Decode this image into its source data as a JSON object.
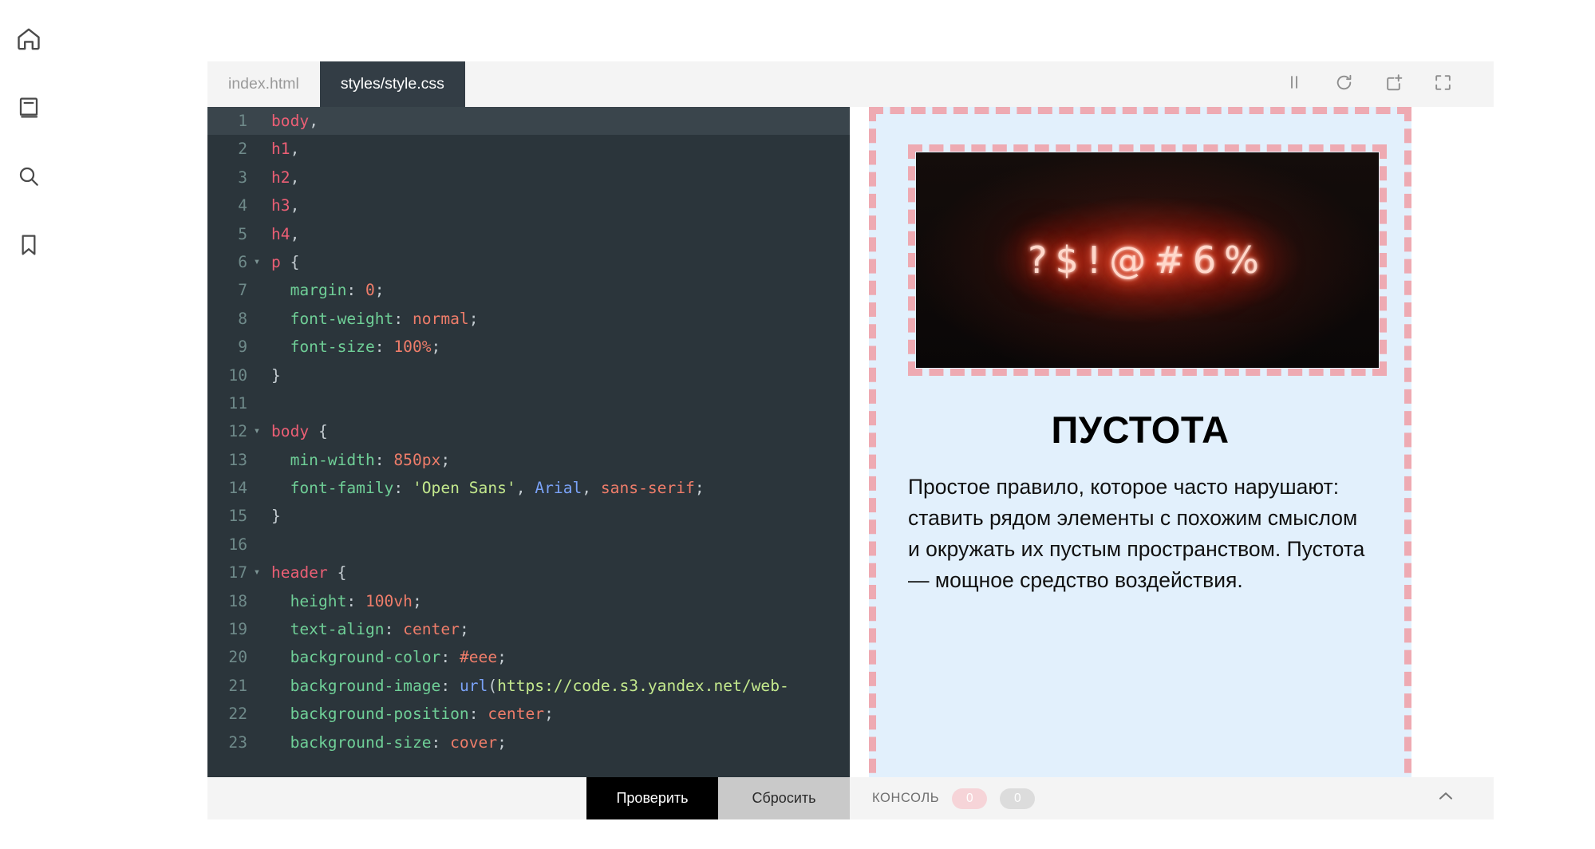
{
  "rail": {
    "items": [
      {
        "name": "home-icon",
        "label": "Home"
      },
      {
        "name": "book-icon",
        "label": "Textbook"
      },
      {
        "name": "search-icon",
        "label": "Search"
      },
      {
        "name": "bookmark-icon",
        "label": "Bookmarks"
      }
    ]
  },
  "editor": {
    "tabs": [
      {
        "label": "index.html",
        "active": false
      },
      {
        "label": "styles/style.css",
        "active": true
      }
    ],
    "active_line": 1,
    "lines": [
      {
        "n": "1",
        "fold": "",
        "cur": true,
        "tokens": [
          {
            "t": "sel",
            "s": "body"
          },
          {
            "t": "pun",
            "s": ","
          }
        ]
      },
      {
        "n": "2",
        "fold": "",
        "cur": false,
        "tokens": [
          {
            "t": "sel",
            "s": "h1"
          },
          {
            "t": "pun",
            "s": ","
          }
        ]
      },
      {
        "n": "3",
        "fold": "",
        "cur": false,
        "tokens": [
          {
            "t": "sel",
            "s": "h2"
          },
          {
            "t": "pun",
            "s": ","
          }
        ]
      },
      {
        "n": "4",
        "fold": "",
        "cur": false,
        "tokens": [
          {
            "t": "sel",
            "s": "h3"
          },
          {
            "t": "pun",
            "s": ","
          }
        ]
      },
      {
        "n": "5",
        "fold": "",
        "cur": false,
        "tokens": [
          {
            "t": "sel",
            "s": "h4"
          },
          {
            "t": "pun",
            "s": ","
          }
        ]
      },
      {
        "n": "6",
        "fold": "▾",
        "cur": false,
        "tokens": [
          {
            "t": "sel",
            "s": "p"
          },
          {
            "t": "pun",
            "s": " {"
          }
        ]
      },
      {
        "n": "7",
        "fold": "",
        "cur": false,
        "tokens": [
          {
            "t": "prop",
            "s": "  margin"
          },
          {
            "t": "pun",
            "s": ": "
          },
          {
            "t": "num",
            "s": "0"
          },
          {
            "t": "pun",
            "s": ";"
          }
        ]
      },
      {
        "n": "8",
        "fold": "",
        "cur": false,
        "tokens": [
          {
            "t": "prop",
            "s": "  font-weight"
          },
          {
            "t": "pun",
            "s": ": "
          },
          {
            "t": "val",
            "s": "normal"
          },
          {
            "t": "pun",
            "s": ";"
          }
        ]
      },
      {
        "n": "9",
        "fold": "",
        "cur": false,
        "tokens": [
          {
            "t": "prop",
            "s": "  font-size"
          },
          {
            "t": "pun",
            "s": ": "
          },
          {
            "t": "num",
            "s": "100%"
          },
          {
            "t": "pun",
            "s": ";"
          }
        ]
      },
      {
        "n": "10",
        "fold": "",
        "cur": false,
        "tokens": [
          {
            "t": "pun",
            "s": "}"
          }
        ]
      },
      {
        "n": "11",
        "fold": "",
        "cur": false,
        "tokens": []
      },
      {
        "n": "12",
        "fold": "▾",
        "cur": false,
        "tokens": [
          {
            "t": "sel",
            "s": "body"
          },
          {
            "t": "pun",
            "s": " {"
          }
        ]
      },
      {
        "n": "13",
        "fold": "",
        "cur": false,
        "tokens": [
          {
            "t": "prop",
            "s": "  min-width"
          },
          {
            "t": "pun",
            "s": ": "
          },
          {
            "t": "num",
            "s": "850px"
          },
          {
            "t": "pun",
            "s": ";"
          }
        ]
      },
      {
        "n": "14",
        "fold": "",
        "cur": false,
        "tokens": [
          {
            "t": "prop",
            "s": "  font-family"
          },
          {
            "t": "pun",
            "s": ": "
          },
          {
            "t": "str",
            "s": "'Open Sans'"
          },
          {
            "t": "pun",
            "s": ", "
          },
          {
            "t": "fn",
            "s": "Arial"
          },
          {
            "t": "pun",
            "s": ", "
          },
          {
            "t": "val",
            "s": "sans-serif"
          },
          {
            "t": "pun",
            "s": ";"
          }
        ]
      },
      {
        "n": "15",
        "fold": "",
        "cur": false,
        "tokens": [
          {
            "t": "pun",
            "s": "}"
          }
        ]
      },
      {
        "n": "16",
        "fold": "",
        "cur": false,
        "tokens": []
      },
      {
        "n": "17",
        "fold": "▾",
        "cur": false,
        "tokens": [
          {
            "t": "sel",
            "s": "header"
          },
          {
            "t": "pun",
            "s": " {"
          }
        ]
      },
      {
        "n": "18",
        "fold": "",
        "cur": false,
        "tokens": [
          {
            "t": "prop",
            "s": "  height"
          },
          {
            "t": "pun",
            "s": ": "
          },
          {
            "t": "num",
            "s": "100vh"
          },
          {
            "t": "pun",
            "s": ";"
          }
        ]
      },
      {
        "n": "19",
        "fold": "",
        "cur": false,
        "tokens": [
          {
            "t": "prop",
            "s": "  text-align"
          },
          {
            "t": "pun",
            "s": ": "
          },
          {
            "t": "val",
            "s": "center"
          },
          {
            "t": "pun",
            "s": ";"
          }
        ]
      },
      {
        "n": "20",
        "fold": "",
        "cur": false,
        "tokens": [
          {
            "t": "prop",
            "s": "  background-color"
          },
          {
            "t": "pun",
            "s": ": "
          },
          {
            "t": "val",
            "s": "#eee"
          },
          {
            "t": "pun",
            "s": ";"
          }
        ]
      },
      {
        "n": "21",
        "fold": "",
        "cur": false,
        "tokens": [
          {
            "t": "prop",
            "s": "  background-image"
          },
          {
            "t": "pun",
            "s": ": "
          },
          {
            "t": "fn",
            "s": "url"
          },
          {
            "t": "pun",
            "s": "("
          },
          {
            "t": "str",
            "s": "https://code.s3.yandex.net/web-"
          }
        ]
      },
      {
        "n": "22",
        "fold": "",
        "cur": false,
        "tokens": [
          {
            "t": "prop",
            "s": "  background-position"
          },
          {
            "t": "pun",
            "s": ": "
          },
          {
            "t": "val",
            "s": "center"
          },
          {
            "t": "pun",
            "s": ";"
          }
        ]
      },
      {
        "n": "23",
        "fold": "",
        "cur": false,
        "tokens": [
          {
            "t": "prop",
            "s": "  background-size"
          },
          {
            "t": "pun",
            "s": ": "
          },
          {
            "t": "val",
            "s": "cover"
          },
          {
            "t": "pun",
            "s": ";"
          }
        ]
      }
    ],
    "check_label": "Проверить",
    "reset_label": "Сбросить"
  },
  "preview": {
    "toolbar": [
      {
        "name": "pause-icon"
      },
      {
        "name": "refresh-icon"
      },
      {
        "name": "open-in-new-icon"
      },
      {
        "name": "fullscreen-icon"
      }
    ],
    "image_alt": "neon-sign-symbols",
    "neon_symbols": "?$!@#6%",
    "title": "ПУСТОТА",
    "paragraph": "Простое правило, которое часто нарушают: ставить рядом элементы с похожим смыслом и окружать их пустым пространством. Пустота — мощное средство воздействия.",
    "bg_color": "#e2f0fc",
    "dash_color": "#eeaab2"
  },
  "console": {
    "label": "КОНСОЛЬ",
    "errors": "0",
    "warnings": "0"
  }
}
